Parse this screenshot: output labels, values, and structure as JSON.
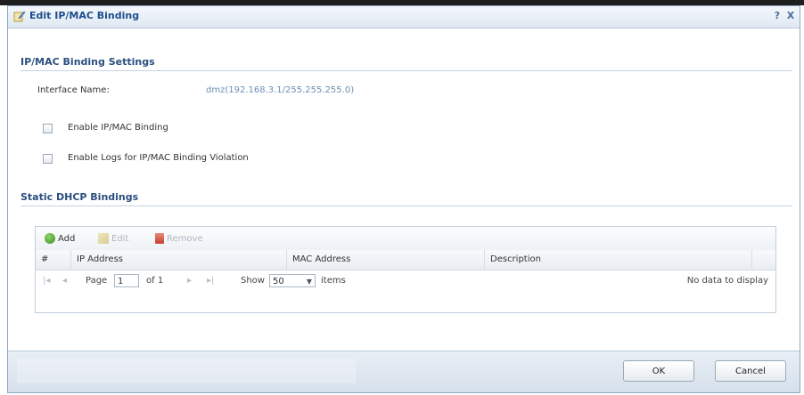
{
  "dialog": {
    "title": "Edit IP/MAC Binding",
    "help_glyph": "?",
    "close_glyph": "X"
  },
  "settings": {
    "section_title": "IP/MAC Binding Settings",
    "interface_label": "Interface Name:",
    "interface_value": "dmz(192.168.3.1/255.255.255.0)",
    "enable_binding_label": "Enable IP/MAC Binding",
    "enable_logs_label": "Enable Logs for IP/MAC Binding Violation"
  },
  "static_dhcp": {
    "section_title": "Static DHCP Bindings",
    "toolbar": {
      "add_label": "Add",
      "edit_label": "Edit",
      "remove_label": "Remove"
    },
    "columns": [
      "#",
      "IP Address",
      "MAC Address",
      "Description"
    ],
    "pager": {
      "first": "|◂",
      "prev": "◂",
      "page_label": "Page",
      "page_value": "1",
      "of_label": "of 1",
      "next": "▸",
      "last": "▸|",
      "show_label": "Show",
      "show_value": "50",
      "items_label": "items",
      "empty_message": "No data to display"
    }
  },
  "footer": {
    "ok_label": "OK",
    "cancel_label": "Cancel"
  }
}
